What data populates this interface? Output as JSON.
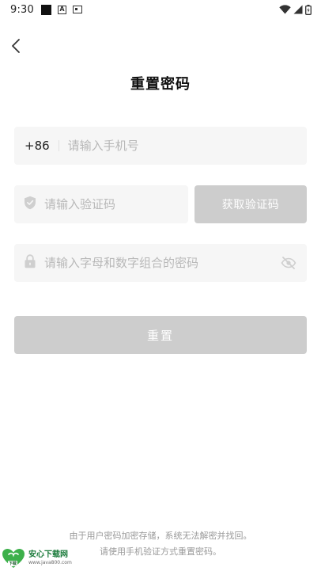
{
  "status_bar": {
    "time": "9:30",
    "left_icons": [
      "notification-square-icon",
      "a-app-icon",
      "card-icon"
    ],
    "right_icons": [
      "wifi-icon",
      "signal-icon",
      "battery-icon"
    ]
  },
  "header": {
    "back_icon": "chevron-left-icon",
    "title": "重置密码"
  },
  "form": {
    "phone": {
      "country_code": "+86",
      "value": "",
      "placeholder": "请输入手机号"
    },
    "code": {
      "icon": "shield-icon",
      "value": "",
      "placeholder": "请输入验证码",
      "get_code_label": "获取验证码"
    },
    "password": {
      "icon": "lock-icon",
      "value": "",
      "placeholder": "请输入字母和数字组合的密码",
      "toggle_icon": "eye-off-icon"
    },
    "submit_label": "重置"
  },
  "footer": {
    "line1": "由于用户密码加密存储，系统无法解密并找回。",
    "line2": "请使用手机验证方式重置密码。"
  },
  "watermark": {
    "name": "安心下载网",
    "url": "www.java800.com",
    "badge": "下载"
  },
  "colors": {
    "disabled_button": "#cdcdcd",
    "field_background": "#f6f6f6",
    "placeholder": "#b8b8b8",
    "footer_text": "#9a9a9a"
  }
}
